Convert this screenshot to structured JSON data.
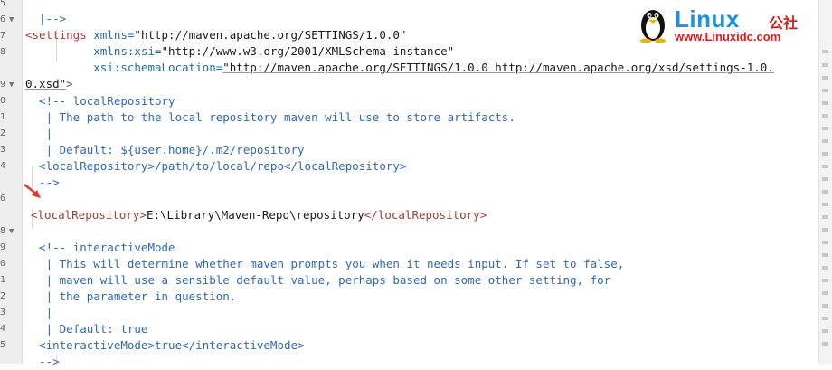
{
  "line_numbers": [
    "5",
    "6",
    "7",
    "8",
    "",
    "9",
    "0",
    "1",
    "2",
    "3",
    "4",
    "",
    "6",
    "",
    "8",
    "9",
    "0",
    "1",
    "2",
    "3",
    "4",
    "5"
  ],
  "logo": {
    "title": "Linux",
    "title_cn": "公社",
    "url": "www.Linuxidc.com"
  },
  "code": {
    "l1": "  |-->",
    "l2_tag": "<settings",
    "l2_attr": " xmlns=",
    "l2_val": "\"http://maven.apache.org/SETTINGS/1.0.0\"",
    "l3_attr": "          xmlns:xsi=",
    "l3_val": "\"http://www.w3.org/2001/XMLSchema-instance\"",
    "l4_attr": "          xsi:schemaLocation=",
    "l4_val": "\"http://maven.apache.org/SETTINGS/1.0.0 http://maven.apache.org/xsd/settings-1.0.",
    "l5_val": "0.xsd\"",
    "l5_tag": ">",
    "c1": "  <!-- localRepository",
    "c2": "   | The path to the local repository maven will use to store artifacts.",
    "c3": "   |",
    "c4": "   | Default: ${user.home}/.m2/repository",
    "c5": "  <localRepository>/path/to/local/repo</localRepository>",
    "c6": "  -->",
    "r_open": "<localRepository>",
    "r_text": "E:\\Library\\Maven-Repo\\repository",
    "r_close": "</localRepository>",
    "i1": "  <!-- interactiveMode",
    "i2": "   | This will determine whether maven prompts you when it needs input. If set to false,",
    "i3": "   | maven will use a sensible default value, perhaps based on some other setting, for",
    "i4": "   | the parameter in question.",
    "i5": "   |",
    "i6": "   | Default: true",
    "i7": "  <interactiveMode>true</interactiveMode>",
    "i8": "  -->"
  }
}
